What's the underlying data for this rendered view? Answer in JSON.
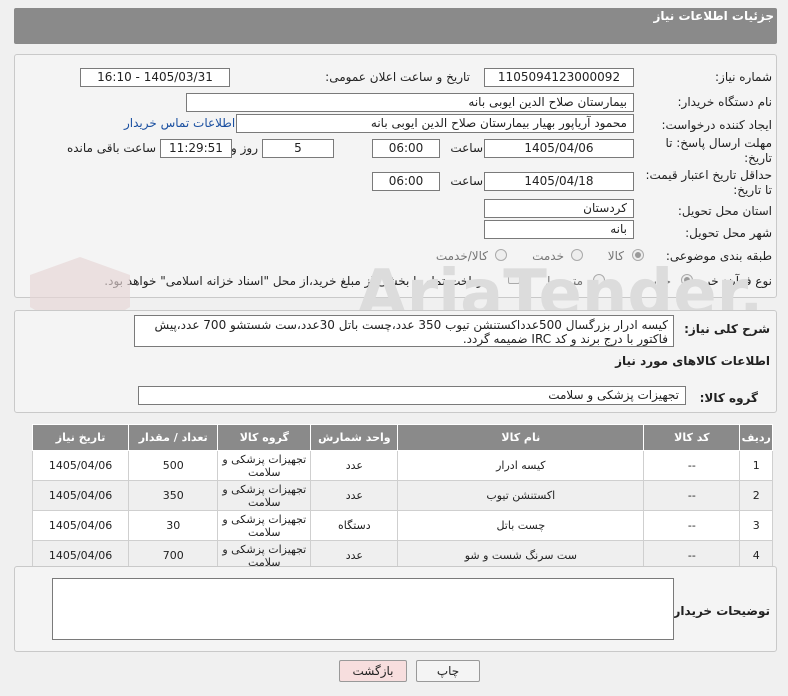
{
  "header": {
    "title": "جزئیات اطلاعات نیاز"
  },
  "fields": {
    "need_number_label": "شماره نیاز:",
    "need_number": "1105094123000092",
    "announce_label": "تاریخ و ساعت اعلان عمومی:",
    "announce_value": "1405/03/31 - 16:10",
    "buyer_org_label": "نام دستگاه خریدار:",
    "buyer_org": "بیمارستان صلاح الدین ایوبی بانه",
    "creator_label": "ایجاد کننده درخواست:",
    "creator": "محمود آریاپور بهیار بیمارستان صلاح الدین ایوبی بانه",
    "contact_link": "اطلاعات تماس خریدار",
    "deadline_label_1": "مهلت ارسال پاسخ: تا",
    "deadline_label_2": "تاریخ:",
    "deadline_date": "1405/04/06",
    "time_label": "ساعت",
    "deadline_time": "06:00",
    "days_value": "5",
    "days_label": "روز و",
    "remaining_time": "11:29:51",
    "remaining_label": "ساعت باقی مانده",
    "price_label_1": "حداقل تاریخ اعتبار قیمت:",
    "price_label_2": "تا تاریخ:",
    "price_date": "1405/04/18",
    "price_time": "06:00",
    "province_label": "استان محل تحویل:",
    "province": "کردستان",
    "city_label": "شهر محل تحویل:",
    "city": "بانه",
    "category_label": "طبقه بندی موضوعی:",
    "category_options": [
      "کالا",
      "خدمت",
      "کالا/خدمت"
    ],
    "process_label": "نوع فرآیند خرید :",
    "process_options": [
      "جزیی",
      "متوسط"
    ],
    "payment_note": "پرداخت تمام یا بخشی از مبلغ خرید،از محل \"اسناد خزانه اسلامی\" خواهد بود."
  },
  "description": {
    "label": "شرح کلی نیاز:",
    "text": "کیسه ادرار بزرگسال 500عدداکستنشن تیوب 350 عدد،چست باتل 30عدد،ست شستشو 700 عدد،پیش فاکتور با درج برند و کد IRC ضمیمه گردد."
  },
  "goods": {
    "section_title": "اطلاعات کالاهای مورد نیاز",
    "group_label": "گروه کالا:",
    "group_value": "تجهیزات پزشکی و سلامت",
    "columns": [
      "ردیف",
      "کد کالا",
      "نام کالا",
      "واحد شمارش",
      "گروه کالا",
      "تعداد / مقدار",
      "تاریخ نیاز"
    ],
    "rows": [
      [
        "1",
        "--",
        "کیسه ادرار",
        "عدد",
        "تجهیزات پزشکی و سلامت",
        "500",
        "1405/04/06"
      ],
      [
        "2",
        "--",
        "اکستنشن تیوب",
        "عدد",
        "تجهیزات پزشکی و سلامت",
        "350",
        "1405/04/06"
      ],
      [
        "3",
        "--",
        "چست باتل",
        "دستگاه",
        "تجهیزات پزشکی و سلامت",
        "30",
        "1405/04/06"
      ],
      [
        "4",
        "--",
        "ست سرنگ شست و شو",
        "عدد",
        "تجهیزات پزشکی و سلامت",
        "700",
        "1405/04/06"
      ]
    ]
  },
  "buyer_notes": {
    "label": "توضیحات خریدار:",
    "value": ""
  },
  "buttons": {
    "print": "چاپ",
    "back": "بازگشت"
  },
  "watermark": {
    "text": "AriaTender.net"
  },
  "colors": {
    "header": "#8a8a8a",
    "link": "#1a4fa0",
    "back_button": "#f7dede"
  }
}
